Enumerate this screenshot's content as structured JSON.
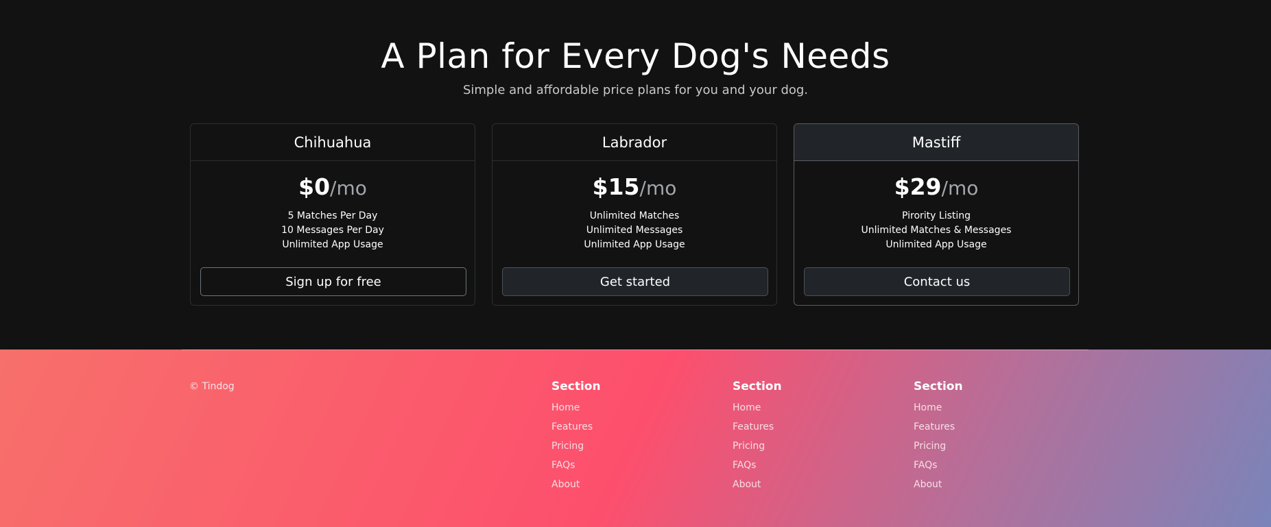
{
  "hero": {
    "title": "A Plan for Every Dog's Needs",
    "subtitle": "Simple and affordable price plans for you and your dog."
  },
  "plans": [
    {
      "name": "Chihuahua",
      "price": "$0",
      "period": "/mo",
      "features": [
        "5 Matches Per Day",
        "10 Messages Per Day",
        "Unlimited App Usage"
      ],
      "button": "Sign up for free"
    },
    {
      "name": "Labrador",
      "price": "$15",
      "period": "/mo",
      "features": [
        "Unlimited Matches",
        "Unlimited Messages",
        "Unlimited App Usage"
      ],
      "button": "Get started"
    },
    {
      "name": "Mastiff",
      "price": "$29",
      "period": "/mo",
      "features": [
        "Pirority Listing",
        "Unlimited Matches & Messages",
        "Unlimited App Usage"
      ],
      "button": "Contact us"
    }
  ],
  "footer": {
    "copyright": "© Tindog",
    "columns": [
      {
        "title": "Section",
        "links": [
          "Home",
          "Features",
          "Pricing",
          "FAQs",
          "About"
        ]
      },
      {
        "title": "Section",
        "links": [
          "Home",
          "Features",
          "Pricing",
          "FAQs",
          "About"
        ]
      },
      {
        "title": "Section",
        "links": [
          "Home",
          "Features",
          "Pricing",
          "FAQs",
          "About"
        ]
      }
    ]
  },
  "colors": {
    "background": "#121212",
    "featured_header": "#212529",
    "footer_gradient": [
      "#f7706b",
      "#fd4f6d",
      "#b0719c",
      "#7a84b9"
    ]
  }
}
